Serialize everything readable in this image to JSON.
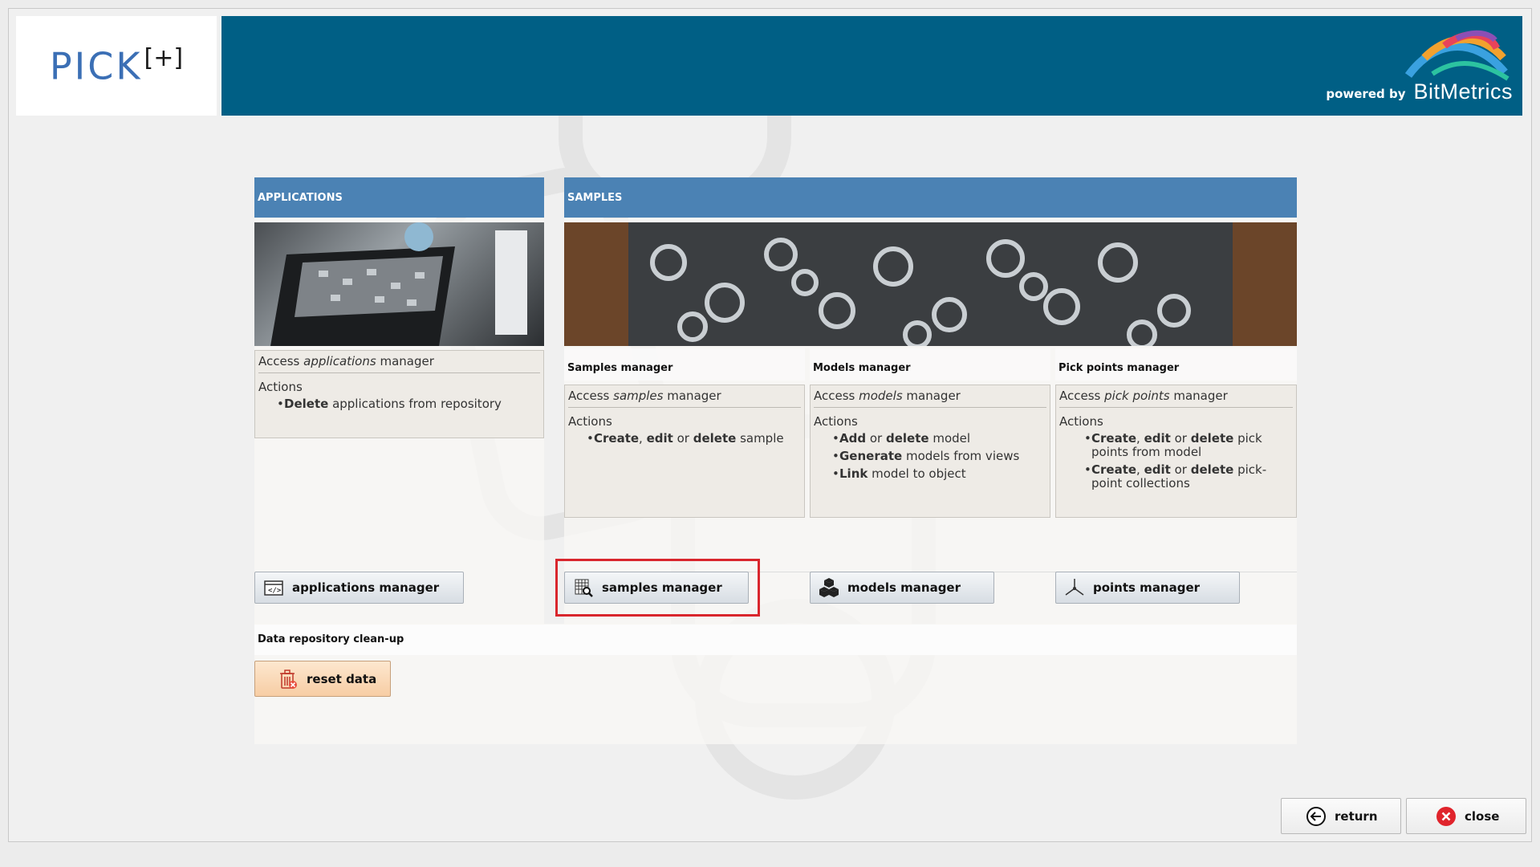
{
  "brand": {
    "logo": "PICK",
    "logo_sup": "[+]",
    "powered_by": "powered by",
    "company": "BitMetrics"
  },
  "applications": {
    "header": "APPLICATIONS",
    "access_prefix": "Access ",
    "access_em": "applications",
    "access_suffix": " manager",
    "actions_label": "Actions",
    "action1_bold": "Delete",
    "action1_rest": " applications from repository",
    "button_label": "applications manager"
  },
  "samples": {
    "header": "SAMPLES",
    "samples_manager": {
      "title": "Samples manager",
      "access_prefix": "Access ",
      "access_em": "samples",
      "access_suffix": " manager",
      "actions_label": "Actions",
      "a1_b1": "Create",
      "a1_t1": ", ",
      "a1_b2": "edit",
      "a1_t2": " or ",
      "a1_b3": "delete",
      "a1_t3": " sample",
      "button_label": "samples manager"
    },
    "models_manager": {
      "title": "Models manager",
      "access_prefix": "Access ",
      "access_em": "models",
      "access_suffix": " manager",
      "actions_label": "Actions",
      "a1_b1": "Add",
      "a1_t1": " or ",
      "a1_b2": "delete",
      "a1_t2": " model",
      "a2_b1": "Generate",
      "a2_t1": " models from views",
      "a3_b1": "Link",
      "a3_t1": " model to object",
      "button_label": "models manager"
    },
    "pick_points_manager": {
      "title": "Pick points manager",
      "access_prefix": "Access ",
      "access_em": "pick points",
      "access_suffix": " manager",
      "actions_label": "Actions",
      "a1_b1": "Create",
      "a1_t1": ", ",
      "a1_b2": "edit",
      "a1_t2": " or ",
      "a1_b3": "delete",
      "a1_t3": " pick points from model",
      "a2_b1": "Create",
      "a2_t1": ", ",
      "a2_b2": "edit",
      "a2_t2": " or ",
      "a2_b3": "delete",
      "a2_t3": " pick-point collections",
      "button_label": "points manager"
    }
  },
  "cleanup": {
    "title": "Data repository clean-up",
    "button_label": "reset data"
  },
  "footer": {
    "return_label": "return",
    "close_label": "close"
  },
  "colors": {
    "banner": "#005f85",
    "header": "#4b82b4",
    "highlight": "#d9262d",
    "close_icon": "#e0242c"
  }
}
